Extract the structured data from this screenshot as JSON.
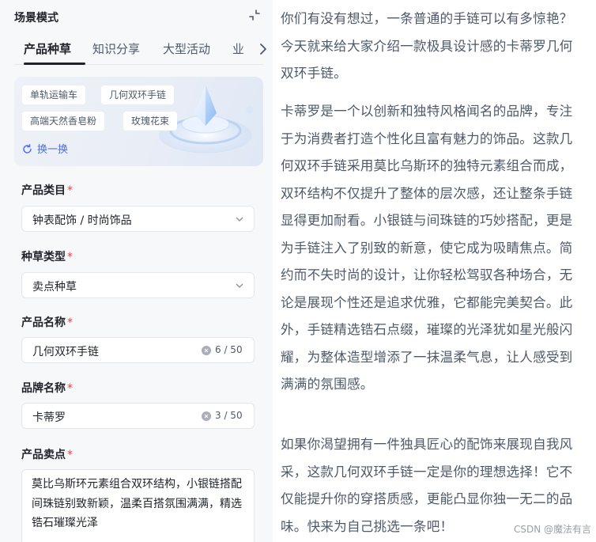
{
  "panel": {
    "title": "场景模式"
  },
  "tabs": [
    {
      "label": "产品种草",
      "active": true
    },
    {
      "label": "知识分享",
      "active": false
    },
    {
      "label": "大型活动",
      "active": false
    },
    {
      "label": "业",
      "active": false
    }
  ],
  "banner": {
    "chips": [
      "单轨运输车",
      "几何双环手链",
      "高端天然香皂粉",
      "玫瑰花束"
    ],
    "refresh_label": "换一换"
  },
  "form": {
    "product_category": {
      "label": "产品类目",
      "required": "*",
      "value": "钟表配饰 / 时尚饰品"
    },
    "seeding_type": {
      "label": "种草类型",
      "required": "*",
      "value": "卖点种草"
    },
    "product_name": {
      "label": "产品名称",
      "required": "*",
      "value": "几何双环手链",
      "count": "6 / 50"
    },
    "brand_name": {
      "label": "品牌名称",
      "required": "*",
      "value": "卡蒂罗",
      "count": "3 / 50"
    },
    "selling_points": {
      "label": "产品卖点",
      "required": "*",
      "value": "莫比乌斯环元素组合双环结构，小银链搭配间珠链别致新颖，温柔百搭氛围满满，精选锆石璀璨光泽"
    }
  },
  "article": {
    "paragraphs": [
      "你们有没有想过，一条普通的手链可以有多惊艳？今天就来给大家介绍一款极具设计感的卡蒂罗几何双环手链。",
      "卡蒂罗是一个以创新和独特风格闻名的品牌，专注于为消费者打造个性化且富有魅力的饰品。这款几何双环手链采用莫比乌斯环的独特元素组合而成，双环结构不仅提升了整体的层次感，还让整条手链显得更加耐看。小银链与间珠链的巧妙搭配，更是为手链注入了别致的新意，使它成为吸睛焦点。简约而不失时尚的设计，让你轻松驾驭各种场合，无论是展现个性还是追求优雅，它都能完美契合。此外，手链精选锆石点缀，璀璨的光泽犹如星光般闪耀，为整体造型增添了一抹温柔气息，让人感受到满满的氛围感。",
      "如果你渴望拥有一件独具匠心的配饰来展现自我风采，这款几何双环手链一定是你的理想选择！它不仅能提升你的穿搭质感，更能凸显你独一无二的品味。快来为自己挑选一条吧！"
    ]
  },
  "watermark": "CSDN @魔法有言",
  "colors": {
    "accent": "#4a6cf7",
    "required": "#f53f3f",
    "panel_bg": "#f7f8fa"
  }
}
